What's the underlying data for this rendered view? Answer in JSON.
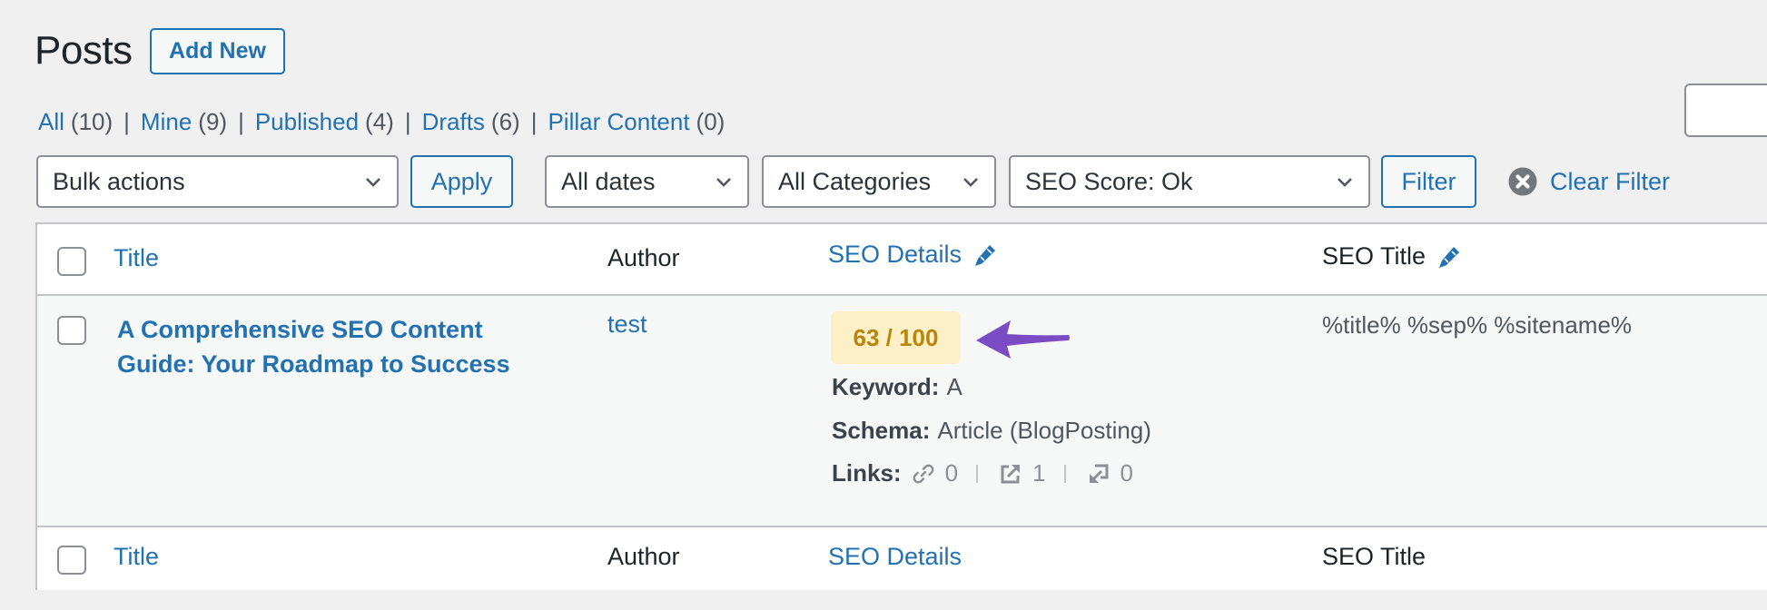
{
  "header": {
    "title": "Posts",
    "add_new_label": "Add New"
  },
  "views": [
    {
      "label": "All",
      "count": "(10)"
    },
    {
      "label": "Mine",
      "count": "(9)"
    },
    {
      "label": "Published",
      "count": "(4)"
    },
    {
      "label": "Drafts",
      "count": "(6)"
    },
    {
      "label": "Pillar Content",
      "count": "(0)"
    }
  ],
  "views_separator": "|",
  "search": {
    "value": "",
    "placeholder": ""
  },
  "toolbar": {
    "bulk_actions": "Bulk actions",
    "apply_label": "Apply",
    "dates": "All dates",
    "categories": "All Categories",
    "seo_score": "SEO Score: Ok",
    "filter_label": "Filter",
    "clear_filter_label": "Clear Filter"
  },
  "table": {
    "columns": {
      "title": "Title",
      "author": "Author",
      "seo_details": "SEO Details",
      "seo_title": "SEO Title"
    },
    "rows": [
      {
        "title": "A Comprehensive SEO Content Guide: Your Roadmap to Success",
        "author": "test",
        "seo_score": "63 / 100",
        "keyword_label": "Keyword:",
        "keyword": "A",
        "schema_label": "Schema:",
        "schema": "Article (BlogPosting)",
        "links_label": "Links:",
        "links_internal": "0",
        "links_external": "1",
        "links_incoming": "0",
        "seo_title": "%title% %sep% %sitename%"
      }
    ]
  },
  "colors": {
    "link": "#2271b1",
    "score_bg": "#fdf0c6",
    "score_text": "#b8860b",
    "annotation_arrow": "#7b4bc4"
  }
}
